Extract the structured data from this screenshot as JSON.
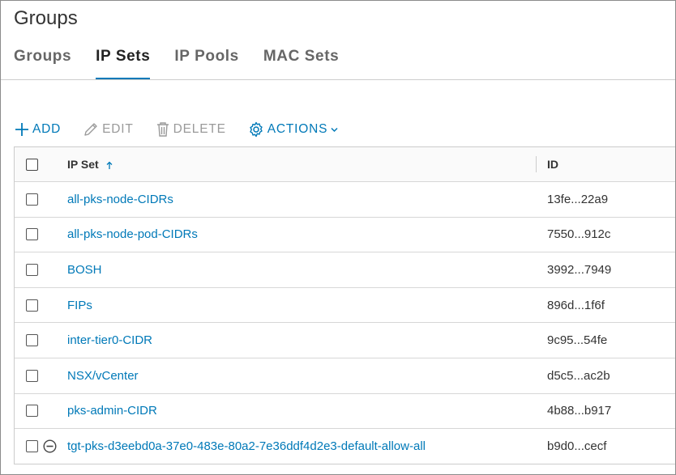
{
  "page": {
    "title": "Groups"
  },
  "tabs": [
    {
      "label": "Groups",
      "active": false
    },
    {
      "label": "IP Sets",
      "active": true
    },
    {
      "label": "IP Pools",
      "active": false
    },
    {
      "label": "MAC Sets",
      "active": false
    }
  ],
  "toolbar": {
    "add_label": "ADD",
    "edit_label": "EDIT",
    "delete_label": "DELETE",
    "actions_label": "ACTIONS",
    "icons": {
      "add": "plus-icon",
      "edit": "pencil-icon",
      "delete": "trash-icon",
      "actions": "gear-icon",
      "actions_caret": "chevron-down-icon"
    }
  },
  "table": {
    "columns": [
      {
        "label": "IP Set",
        "sort": "ascending"
      },
      {
        "label": "ID"
      }
    ],
    "rows": [
      {
        "name": "all-pks-node-CIDRs",
        "id": "13fe...22a9"
      },
      {
        "name": "all-pks-node-pod-CIDRs",
        "id": "7550...912c"
      },
      {
        "name": "BOSH",
        "id": "3992...7949"
      },
      {
        "name": "FIPs",
        "id": "896d...1f6f"
      },
      {
        "name": "inter-tier0-CIDR",
        "id": "9c95...54fe"
      },
      {
        "name": "NSX/vCenter",
        "id": "d5c5...ac2b"
      },
      {
        "name": "pks-admin-CIDR",
        "id": "4b88...b917"
      },
      {
        "name": "tgt-pks-d3eebd0a-37e0-483e-80a2-7e36ddf4d2e3-default-allow-all",
        "id": "b9d0...cecf",
        "protected": true
      }
    ]
  },
  "colors": {
    "accent": "#0079b8",
    "disabled": "#9a9a9a",
    "text": "#333333"
  }
}
